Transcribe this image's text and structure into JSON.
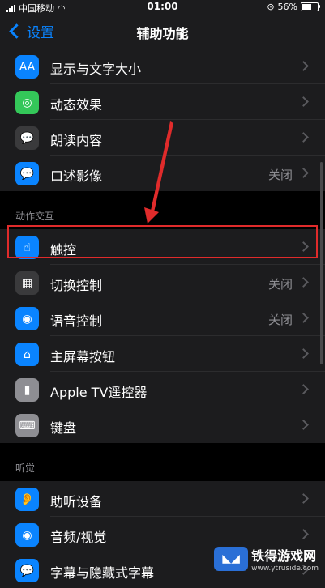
{
  "status": {
    "carrier": "中国移动",
    "time": "01:00",
    "battery": "56%"
  },
  "nav": {
    "back_label": "设置",
    "title": "辅助功能"
  },
  "sections": [
    {
      "header": "",
      "items": [
        {
          "label": "显示与文字大小",
          "value": "",
          "icon": "aa-icon",
          "color": "#0a84ff",
          "glyph": "AA"
        },
        {
          "label": "动态效果",
          "value": "",
          "icon": "motion-icon",
          "color": "#34c759",
          "glyph": "◎"
        },
        {
          "label": "朗读内容",
          "value": "",
          "icon": "speech-bubble-icon",
          "color": "#3a3a3c",
          "glyph": "💬"
        },
        {
          "label": "口述影像",
          "value": "关闭",
          "icon": "audio-description-icon",
          "color": "#0a84ff",
          "glyph": "💬"
        }
      ]
    },
    {
      "header": "动作交互",
      "items": [
        {
          "label": "触控",
          "value": "",
          "icon": "hand-touch-icon",
          "color": "#0a84ff",
          "glyph": "☝"
        },
        {
          "label": "切换控制",
          "value": "关闭",
          "icon": "switch-control-icon",
          "color": "#3a3a3c",
          "glyph": "▦"
        },
        {
          "label": "语音控制",
          "value": "关闭",
          "icon": "voice-control-icon",
          "color": "#0a84ff",
          "glyph": "◉"
        },
        {
          "label": "主屏幕按钮",
          "value": "",
          "icon": "home-button-icon",
          "color": "#0a84ff",
          "glyph": "⌂"
        },
        {
          "label": "Apple TV遥控器",
          "value": "",
          "icon": "remote-icon",
          "color": "#8e8e93",
          "glyph": "▮"
        },
        {
          "label": "键盘",
          "value": "",
          "icon": "keyboard-icon",
          "color": "#8e8e93",
          "glyph": "⌨"
        }
      ]
    },
    {
      "header": "听觉",
      "items": [
        {
          "label": "助听设备",
          "value": "",
          "icon": "ear-icon",
          "color": "#0a84ff",
          "glyph": "👂"
        },
        {
          "label": "音频/视觉",
          "value": "",
          "icon": "audio-visual-icon",
          "color": "#0a84ff",
          "glyph": "◉"
        },
        {
          "label": "字幕与隐藏式字幕",
          "value": "",
          "icon": "subtitles-icon",
          "color": "#0a84ff",
          "glyph": "💬"
        }
      ]
    }
  ],
  "watermark": {
    "brand": "铁得游戏网",
    "url": "www.ytruside.com"
  }
}
